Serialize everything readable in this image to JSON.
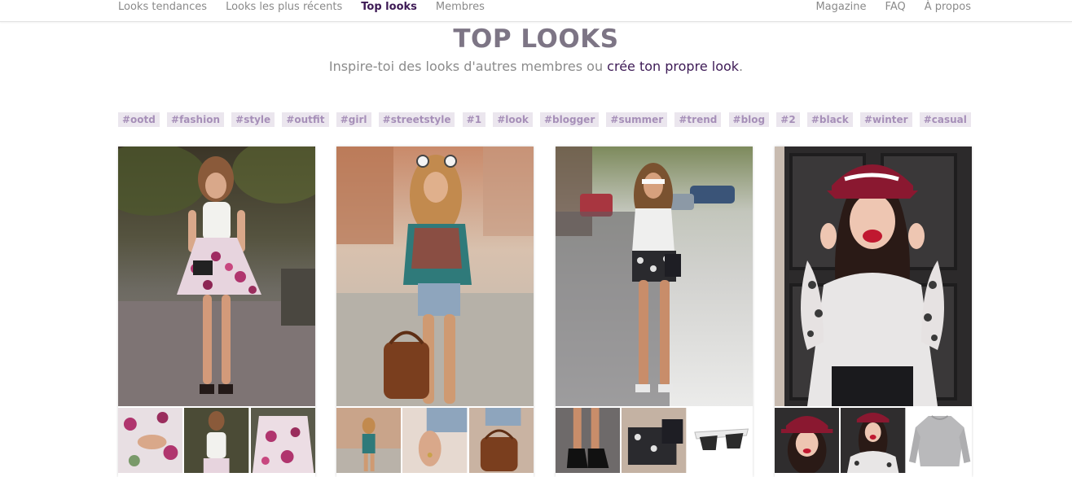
{
  "nav": {
    "left": [
      "Looks tendances",
      "Looks les plus récents",
      "Top looks",
      "Membres"
    ],
    "right": [
      "Magazine",
      "FAQ",
      "À propos"
    ],
    "active_item": "Top looks"
  },
  "header": {
    "title": "TOP LOOKS",
    "subtitle_prefix": "Inspire-toi des looks d'autres membres ou ",
    "subtitle_link": "crée ton propre look",
    "subtitle_suffix": "."
  },
  "tags": [
    "#ootd",
    "#fashion",
    "#style",
    "#outfit",
    "#girl",
    "#streetstyle",
    "#1",
    "#look",
    "#blogger",
    "#summer",
    "#trend",
    "#blog",
    "#2",
    "#black",
    "#winter",
    "#casual"
  ],
  "colors": {
    "brand_purple": "#3d1a55",
    "tag_bg": "#ebe6ee",
    "tag_text": "#a68fb8",
    "title_gray": "#7d7585"
  },
  "looks": [
    {
      "main": "woman-floral-skirt-photo",
      "thumbs": [
        "floral-fabric-hands-photo",
        "white-top-photo",
        "floral-skirt-photo"
      ]
    },
    {
      "main": "woman-printed-blouse-photo",
      "thumbs": [
        "street-outfit-photo",
        "denim-shorts-rings-photo",
        "brown-satchel-photo"
      ]
    },
    {
      "main": "woman-black-shorts-photo",
      "thumbs": [
        "black-heels-photo",
        "patterned-shorts-bag-photo",
        "white-sunglasses-photo"
      ]
    },
    {
      "main": "woman-burgundy-cap-photo",
      "thumbs": [
        "cap-portrait-photo",
        "cap-sweater-photo",
        "grey-sweater-photo"
      ]
    }
  ]
}
